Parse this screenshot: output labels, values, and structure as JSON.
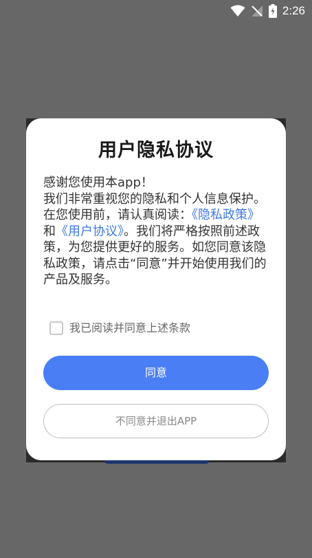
{
  "status_bar": {
    "time": "2:26",
    "icons": [
      "wifi-icon",
      "no-signal-icon",
      "battery-charging-icon"
    ]
  },
  "dialog": {
    "title": "用户隐私协议",
    "greeting": "感谢您使用本app！",
    "intro": "我们非常重视您的隐私和个人信息保护。在您使用前，请认真阅读：",
    "privacy_link": "《隐私政策》",
    "and_text": "和",
    "user_agreement_link": "《用户协议》",
    "outro": "。我们将严格按照前述政策，为您提供更好的服务。如您同意该隐私政策，请点击“同意”并开始使用我们的产品及服务。",
    "checkbox_label": "我已阅读并同意上述条款",
    "checkbox_checked": false,
    "agree_button": "同意",
    "disagree_button": "不同意并退出APP"
  },
  "colors": {
    "accent": "#4a7ef5",
    "link": "#3f78e6",
    "overlay": "#676767"
  }
}
